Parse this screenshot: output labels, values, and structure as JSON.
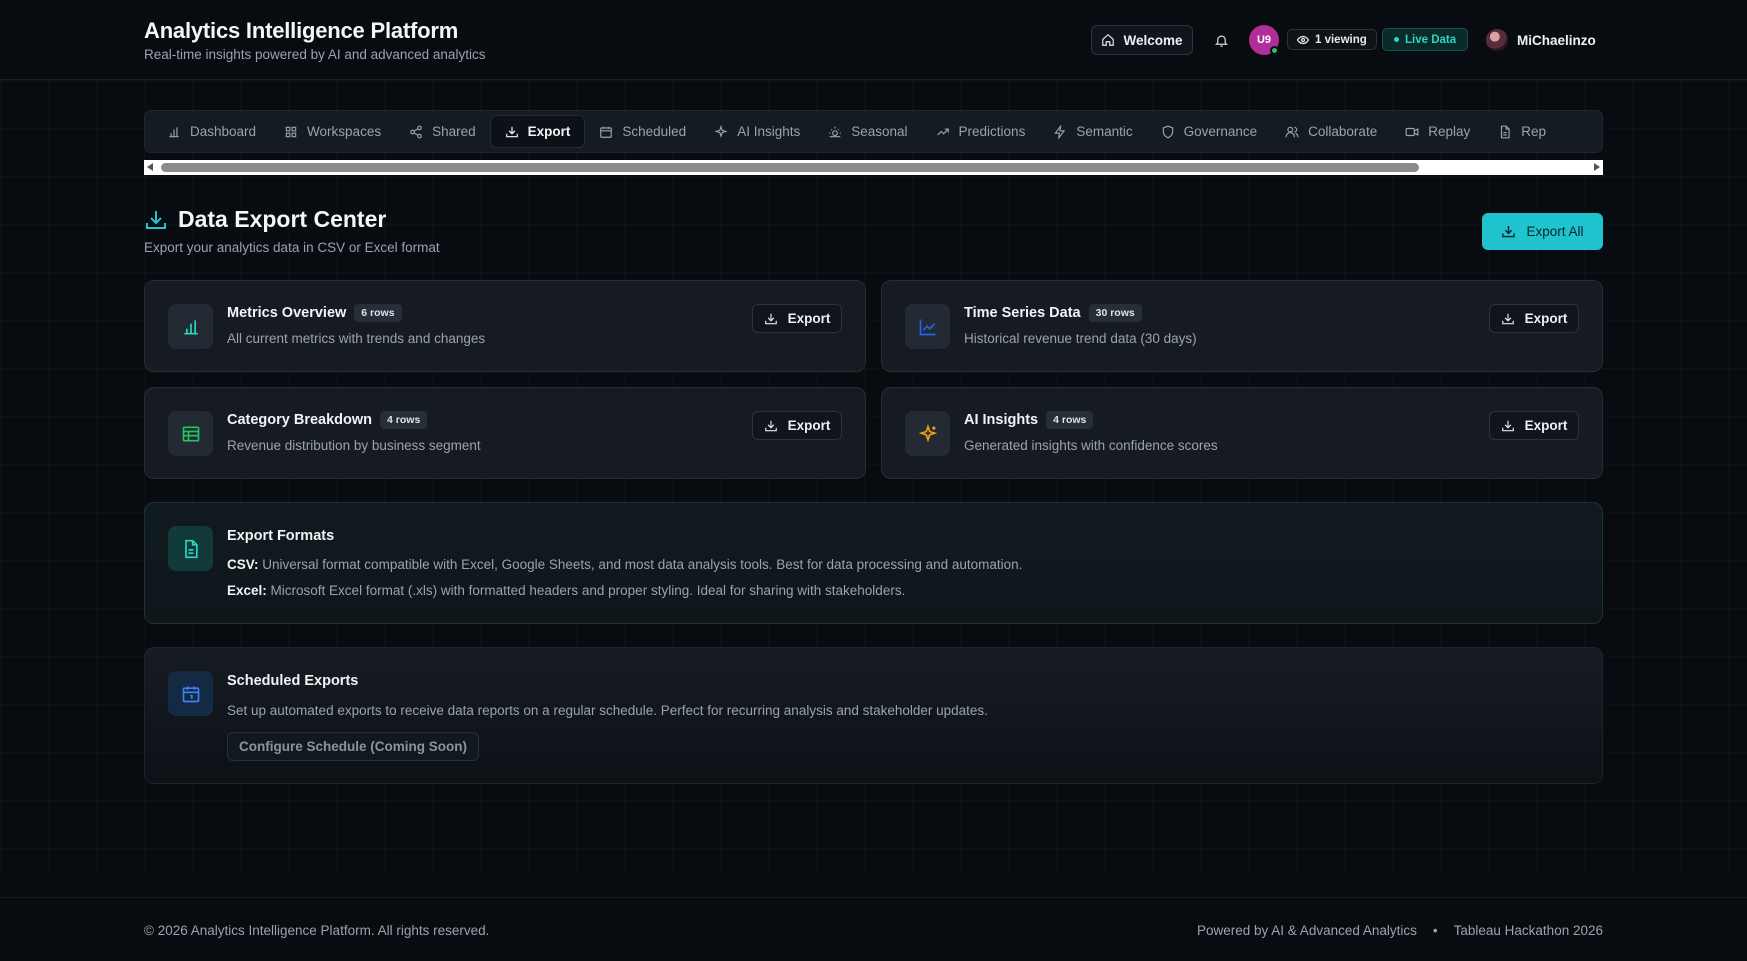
{
  "header": {
    "title": "Analytics Intelligence Platform",
    "subtitle": "Real-time insights powered by AI and advanced analytics",
    "welcome_label": "Welcome",
    "avatar_initials": "U9",
    "viewing_label": "1 viewing",
    "live_label": "Live Data",
    "user_name": "MiChaelinzo"
  },
  "tabs": [
    {
      "label": "Dashboard",
      "icon": "bar-chart-icon",
      "active": false
    },
    {
      "label": "Workspaces",
      "icon": "grid-icon",
      "active": false
    },
    {
      "label": "Shared",
      "icon": "share-icon",
      "active": false
    },
    {
      "label": "Export",
      "icon": "download-icon",
      "active": true
    },
    {
      "label": "Scheduled",
      "icon": "calendar-icon",
      "active": false
    },
    {
      "label": "AI Insights",
      "icon": "sparkle-icon",
      "active": false
    },
    {
      "label": "Seasonal",
      "icon": "sun-icon",
      "active": false
    },
    {
      "label": "Predictions",
      "icon": "trend-up-icon",
      "active": false
    },
    {
      "label": "Semantic",
      "icon": "lightning-icon",
      "active": false
    },
    {
      "label": "Governance",
      "icon": "shield-icon",
      "active": false
    },
    {
      "label": "Collaborate",
      "icon": "users-icon",
      "active": false
    },
    {
      "label": "Replay",
      "icon": "video-icon",
      "active": false
    },
    {
      "label": "Rep",
      "icon": "file-icon",
      "active": false
    }
  ],
  "section": {
    "title": "Data Export Center",
    "subtitle": "Export your analytics data in CSV or Excel format",
    "export_all_label": "Export All"
  },
  "cards": [
    {
      "title": "Metrics Overview",
      "badge": "6 rows",
      "desc": "All current metrics with trends and changes",
      "action": "Export",
      "icon": "bar-chart-icon"
    },
    {
      "title": "Time Series Data",
      "badge": "30 rows",
      "desc": "Historical revenue trend data (30 days)",
      "action": "Export",
      "icon": "line-chart-icon"
    },
    {
      "title": "Category Breakdown",
      "badge": "4 rows",
      "desc": "Revenue distribution by business segment",
      "action": "Export",
      "icon": "table-icon"
    },
    {
      "title": "AI Insights",
      "badge": "4 rows",
      "desc": "Generated insights with confidence scores",
      "action": "Export",
      "icon": "sparkle-icon"
    }
  ],
  "formats": {
    "title": "Export Formats",
    "csv_label": "CSV:",
    "csv_text": "Universal format compatible with Excel, Google Sheets, and most data analysis tools. Best for data processing and automation.",
    "excel_label": "Excel:",
    "excel_text": "Microsoft Excel format (.xls) with formatted headers and proper styling. Ideal for sharing with stakeholders."
  },
  "scheduled": {
    "title": "Scheduled Exports",
    "desc": "Set up automated exports to receive data reports on a regular schedule. Perfect for recurring analysis and stakeholder updates.",
    "button_label": "Configure Schedule (Coming Soon)"
  },
  "footer": {
    "copyright": "© 2026 Analytics Intelligence Platform. All rights reserved.",
    "powered": "Powered by AI & Advanced Analytics",
    "separator": "•",
    "event": "Tableau Hackathon 2026"
  },
  "colors": {
    "accent": "#1fc4cf",
    "background": "#080b10",
    "live": "#2dd4bf",
    "avatar": "#b02d9a"
  }
}
